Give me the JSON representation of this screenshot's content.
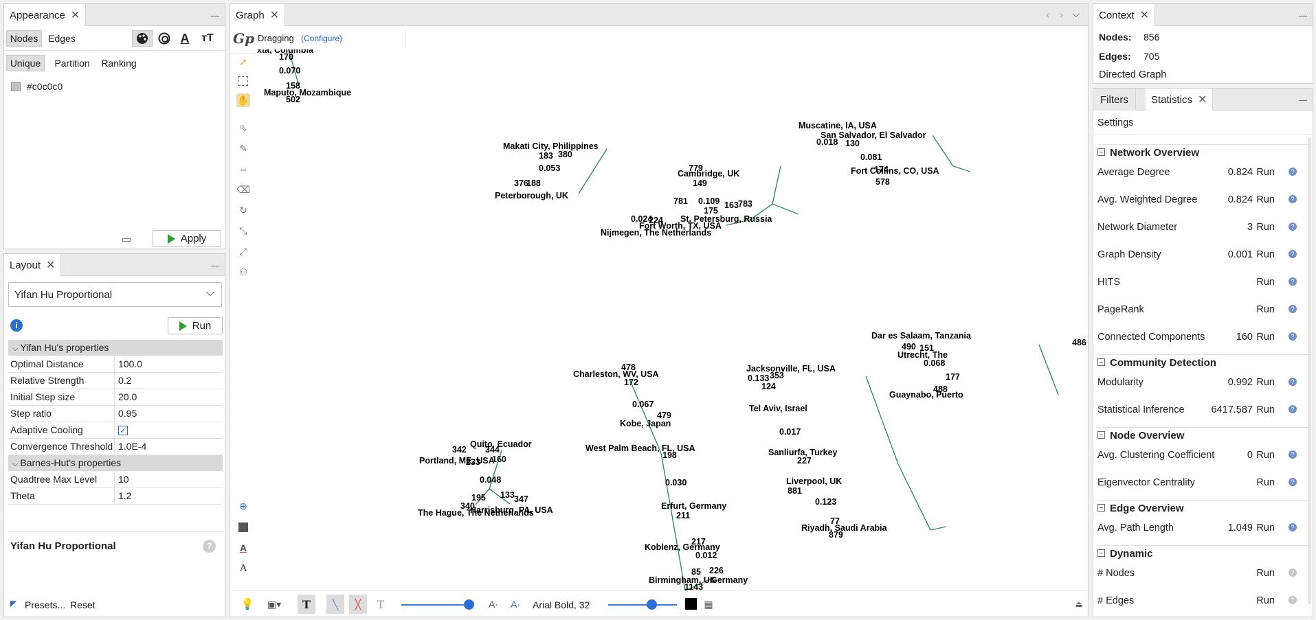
{
  "appearance": {
    "tab": "Appearance",
    "modes": [
      "Nodes",
      "Edges"
    ],
    "subtabs": [
      "Unique",
      "Partition",
      "Ranking"
    ],
    "color_value": "#c0c0c0",
    "apply_label": "Apply"
  },
  "layout": {
    "tab": "Layout",
    "algorithm": "Yifan Hu Proportional",
    "run_label": "Run",
    "group1": "Yifan Hu's properties",
    "props1": [
      {
        "k": "Optimal Distance",
        "v": "100.0"
      },
      {
        "k": "Relative Strength",
        "v": "0.2"
      },
      {
        "k": "Initial Step size",
        "v": "20.0"
      },
      {
        "k": "Step ratio",
        "v": "0.95"
      },
      {
        "k": "Adaptive Cooling",
        "v": ""
      },
      {
        "k": "Convergence Threshold",
        "v": "1.0E-4"
      }
    ],
    "group2": "Barnes-Hut's properties",
    "props2": [
      {
        "k": "Quadtree Max Level",
        "v": "10"
      },
      {
        "k": "Theta",
        "v": "1.2"
      }
    ],
    "desc_title": "Yifan Hu Proportional",
    "presets_label": "Presets...",
    "reset_label": "Reset"
  },
  "graph": {
    "tab": "Graph",
    "mode": "Dragging",
    "configure": "(Configure)",
    "font_label": "Arial Bold, 32",
    "labels": [
      {
        "t": "xta, Columbia"
      },
      {
        "t": "170"
      },
      {
        "t": "0.070"
      },
      {
        "t": "158"
      },
      {
        "t": "Maputo, Mozambique"
      },
      {
        "t": "502"
      },
      {
        "t": "Makati City, Philippines"
      },
      {
        "t": "183"
      },
      {
        "t": "380"
      },
      {
        "t": "0.053"
      },
      {
        "t": "376"
      },
      {
        "t": "188"
      },
      {
        "t": "Peterborough, UK"
      },
      {
        "t": "779"
      },
      {
        "t": "Cambridge, UK"
      },
      {
        "t": "149"
      },
      {
        "t": "781"
      },
      {
        "t": "0.109"
      },
      {
        "t": "163"
      },
      {
        "t": "783"
      },
      {
        "t": "175"
      },
      {
        "t": "0.024"
      },
      {
        "t": "224"
      },
      {
        "t": "St. Petersburg, Russia"
      },
      {
        "t": "Fort Worth, TX, USA"
      },
      {
        "t": "Nijmegen, The Netherlands"
      },
      {
        "t": "Muscatine, IA, USA"
      },
      {
        "t": "San Salvador, El Salvador"
      },
      {
        "t": "0.018"
      },
      {
        "t": "130"
      },
      {
        "t": "0.081"
      },
      {
        "t": "174"
      },
      {
        "t": "Fort Collins, CO, USA"
      },
      {
        "t": "578"
      },
      {
        "t": "Dar es Salaam, Tanzania"
      },
      {
        "t": "490"
      },
      {
        "t": "151"
      },
      {
        "t": "486"
      },
      {
        "t": "Utrecht, The"
      },
      {
        "t": "0.068"
      },
      {
        "t": "177"
      },
      {
        "t": "488"
      },
      {
        "t": "Guaynabo, Puerto"
      },
      {
        "t": "478"
      },
      {
        "t": "Charleston, WV, USA"
      },
      {
        "t": "172"
      },
      {
        "t": "0.067"
      },
      {
        "t": "479"
      },
      {
        "t": "Kobe, Japan"
      },
      {
        "t": "West Palm Beach, FL, USA"
      },
      {
        "t": "198"
      },
      {
        "t": "0.030"
      },
      {
        "t": "Erfurt, Germany"
      },
      {
        "t": "211"
      },
      {
        "t": "217"
      },
      {
        "t": "Koblenz, Germany"
      },
      {
        "t": "0.012"
      },
      {
        "t": "85"
      },
      {
        "t": "226"
      },
      {
        "t": "Birmingham, UK"
      },
      {
        "t": "Germany"
      },
      {
        "t": "1143"
      },
      {
        "t": "Jacksonville, FL, USA"
      },
      {
        "t": "0.133"
      },
      {
        "t": "353"
      },
      {
        "t": "124"
      },
      {
        "t": "Tel Aviv, Israel"
      },
      {
        "t": "0.017"
      },
      {
        "t": "Sanliurfa, Turkey"
      },
      {
        "t": "227"
      },
      {
        "t": "Liverpool, UK"
      },
      {
        "t": "881"
      },
      {
        "t": "0.123"
      },
      {
        "t": "77"
      },
      {
        "t": "Riyadh, Saudi Arabia"
      },
      {
        "t": "879"
      },
      {
        "t": "Quito, Ecuador"
      },
      {
        "t": "342"
      },
      {
        "t": "344"
      },
      {
        "t": "Portland, ME, USA"
      },
      {
        "t": "233"
      },
      {
        "t": "160"
      },
      {
        "t": "0.048"
      },
      {
        "t": "195"
      },
      {
        "t": "133"
      },
      {
        "t": "347"
      },
      {
        "t": "340"
      },
      {
        "t": "Harrisburg, PA, USA"
      },
      {
        "t": "The Hague, The Netherlands"
      }
    ]
  },
  "context": {
    "tab": "Context",
    "nodes_label": "Nodes:",
    "nodes": "856",
    "edges_label": "Edges:",
    "edges": "705",
    "type": "Directed Graph"
  },
  "stats_panel": {
    "tabs": [
      "Filters",
      "Statistics"
    ],
    "settings": "Settings",
    "run": "Run",
    "sections": [
      {
        "title": "Network Overview",
        "items": [
          {
            "n": "Average Degree",
            "v": "0.824"
          },
          {
            "n": "Avg. Weighted Degree",
            "v": "0.824"
          },
          {
            "n": "Network Diameter",
            "v": "3"
          },
          {
            "n": "Graph Density",
            "v": "0.001"
          },
          {
            "n": "HITS",
            "v": ""
          },
          {
            "n": "PageRank",
            "v": ""
          },
          {
            "n": "Connected Components",
            "v": "160"
          }
        ]
      },
      {
        "title": "Community Detection",
        "items": [
          {
            "n": "Modularity",
            "v": "0.992"
          },
          {
            "n": "Statistical Inference",
            "v": "6417.587"
          }
        ]
      },
      {
        "title": "Node Overview",
        "items": [
          {
            "n": "Avg. Clustering Coefficient",
            "v": "0"
          },
          {
            "n": "Eigenvector Centrality",
            "v": ""
          }
        ]
      },
      {
        "title": "Edge Overview",
        "items": [
          {
            "n": "Avg. Path Length",
            "v": "1.049"
          }
        ]
      },
      {
        "title": "Dynamic",
        "items": [
          {
            "n": "# Nodes",
            "v": ""
          },
          {
            "n": "# Edges",
            "v": ""
          }
        ]
      }
    ]
  },
  "colors": {
    "accent": "#2da02d",
    "edge": "#2f8f5f",
    "link": "#1f5fbf"
  }
}
